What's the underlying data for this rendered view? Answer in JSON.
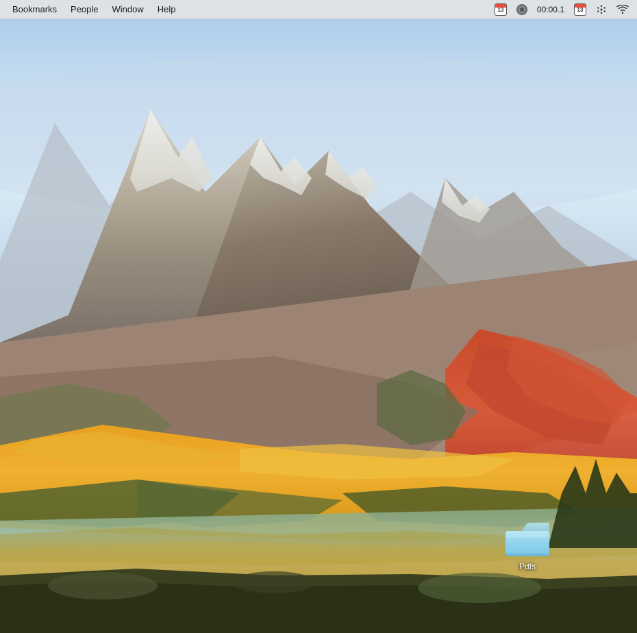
{
  "menubar": {
    "items": [
      {
        "label": "Bookmarks",
        "id": "bookmarks"
      },
      {
        "label": "People",
        "id": "people"
      },
      {
        "label": "Window",
        "id": "window"
      },
      {
        "label": "Help",
        "id": "help"
      }
    ],
    "status": {
      "calendar_num": "13",
      "timer": "00:00.1",
      "calendar_num2": "13"
    }
  },
  "desktop": {
    "folder": {
      "label": "Pdfs"
    }
  },
  "icons": {
    "calendar": "📅",
    "record": "⏺",
    "wifi": "wifi",
    "bluetooth": "✳"
  }
}
